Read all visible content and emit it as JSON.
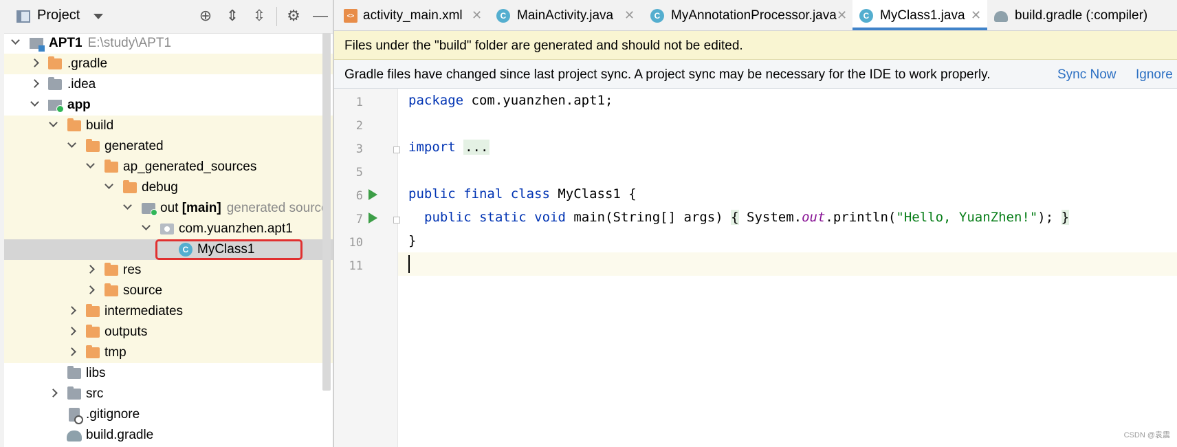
{
  "project_panel": {
    "title": "Project",
    "header_icons": [
      "locate-icon",
      "expand-all-icon",
      "collapse-all-icon",
      "gear-icon",
      "hide-icon"
    ],
    "tree": [
      {
        "label": "APT1",
        "secondary": "E:\\study\\APT1",
        "icon": "project-icon",
        "expanded": true
      },
      {
        "label": ".gradle",
        "icon": "folder-icon",
        "expanded": false
      },
      {
        "label": ".idea",
        "icon": "folder-icon",
        "expanded": false
      },
      {
        "label": "app",
        "icon": "module-icon",
        "expanded": true
      },
      {
        "label": "build",
        "icon": "folder-icon",
        "expanded": true
      },
      {
        "label": "generated",
        "icon": "folder-icon",
        "expanded": true
      },
      {
        "label": "ap_generated_sources",
        "icon": "folder-icon",
        "expanded": true
      },
      {
        "label": "debug",
        "icon": "folder-icon",
        "expanded": true
      },
      {
        "label": "out",
        "label_bold": "[main]",
        "secondary": "generated source",
        "icon": "source-root-icon",
        "expanded": true
      },
      {
        "label": "com.yuanzhen.apt1",
        "icon": "package-icon",
        "expanded": true
      },
      {
        "label": "MyClass1",
        "icon": "class-icon",
        "selected": true
      },
      {
        "label": "res",
        "icon": "folder-icon",
        "expanded": false
      },
      {
        "label": "source",
        "icon": "folder-icon",
        "expanded": false
      },
      {
        "label": "intermediates",
        "icon": "folder-icon",
        "expanded": false
      },
      {
        "label": "outputs",
        "icon": "folder-icon",
        "expanded": false
      },
      {
        "label": "tmp",
        "icon": "folder-icon",
        "expanded": false
      },
      {
        "label": "libs",
        "icon": "folder-icon"
      },
      {
        "label": "src",
        "icon": "folder-icon",
        "expanded": false
      },
      {
        "label": ".gitignore",
        "icon": "gitignore-file-icon"
      },
      {
        "label": "build.gradle",
        "icon": "gradle-file-icon"
      }
    ]
  },
  "editor": {
    "tabs": [
      {
        "label": "activity_main.xml",
        "icon": "xml-file-icon",
        "active": false
      },
      {
        "label": "MainActivity.java",
        "icon": "class-icon",
        "active": false
      },
      {
        "label": "MyAnnotationProcessor.java",
        "icon": "class-icon",
        "active": false
      },
      {
        "label": "MyClass1.java",
        "icon": "class-icon",
        "active": true
      },
      {
        "label": "build.gradle (:compiler)",
        "icon": "gradle-file-icon",
        "active": false
      }
    ],
    "notice_build": "Files under the \"build\" folder are generated and should not be edited.",
    "notice_gradle": {
      "text": "Gradle files have changed since last project sync. A project sync may be necessary for the IDE to work properly.",
      "sync_now": "Sync Now",
      "ignore": "Ignore"
    },
    "line_numbers": [
      "1",
      "2",
      "3",
      "5",
      "6",
      "7",
      "10",
      "11"
    ],
    "code": {
      "l1_kw": "package",
      "l1_rest": " com.yuanzhen.apt1;",
      "l3_kw": "import",
      "l3_fold": "...",
      "l6_kw": "public final class",
      "l6_rest": " MyClass1 {",
      "l7_kw": "public static void",
      "l7_a": " main(String[] args) ",
      "l7_ob": "{",
      "l7_b": " System.",
      "l7_field": "out",
      "l7_c": ".println(",
      "l7_str": "\"Hello, YuanZhen!\"",
      "l7_d": "); ",
      "l7_cb": "}",
      "l10": "}"
    }
  },
  "watermark": "CSDN @袁震"
}
